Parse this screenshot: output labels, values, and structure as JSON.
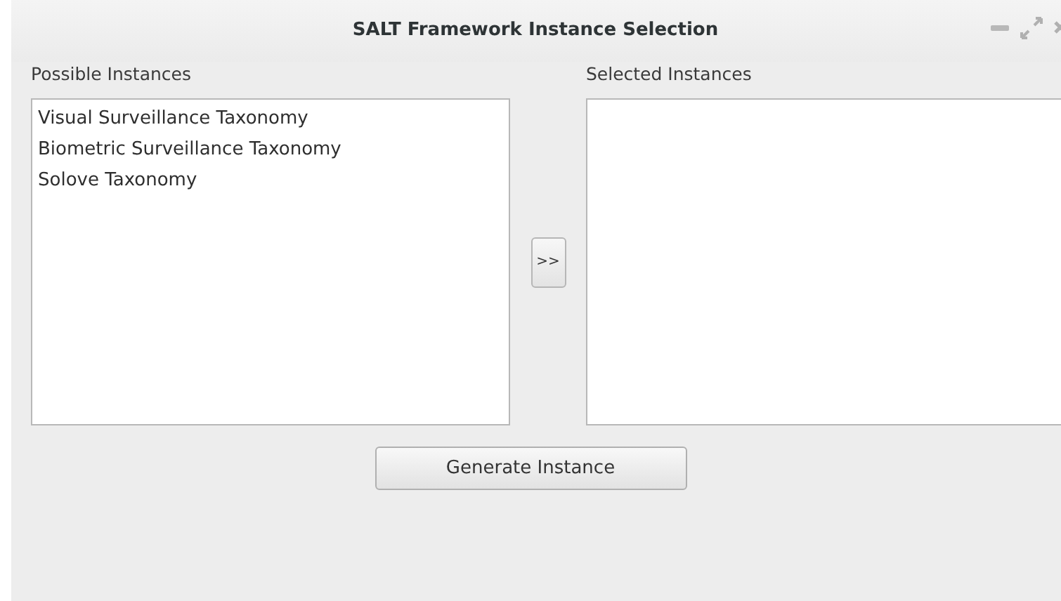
{
  "window": {
    "title": "SALT Framework Instance Selection"
  },
  "possible": {
    "label": "Possible Instances",
    "items": [
      {
        "text": "Visual Surveillance Taxonomy"
      },
      {
        "text": "Biometric Surveillance Taxonomy"
      },
      {
        "text": "Solove Taxonomy"
      }
    ]
  },
  "move_button": ">>",
  "selected": {
    "label": "Selected Instances"
  },
  "generate_button": "Generate Instance"
}
